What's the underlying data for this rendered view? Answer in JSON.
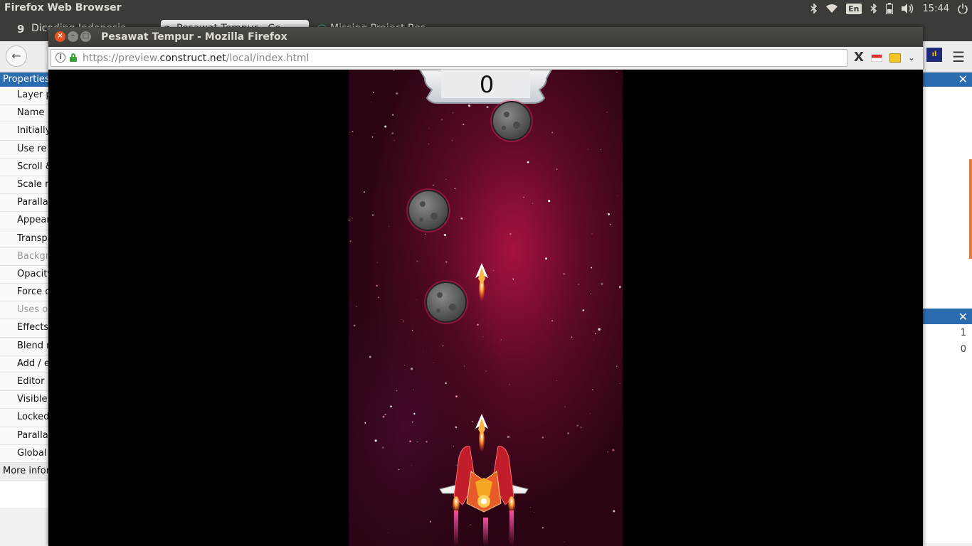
{
  "topbar": {
    "app_title": "Firefox Web Browser",
    "keyboard_layout": "En",
    "clock": "15:44",
    "icons": [
      "bluetooth-icon",
      "wifi-icon",
      "keyboard-layout-icon",
      "bluetooth-icon",
      "battery-icon",
      "volume-icon",
      "power-icon"
    ]
  },
  "background_window": {
    "tabs": [
      {
        "label": "Dicoding Indonesia",
        "icon": "dicoding-icon"
      },
      {
        "label": "Pesawat Tempur - Co",
        "icon": "construct-icon"
      },
      {
        "label": "Missing Project Res",
        "icon": "circle-icon"
      }
    ],
    "properties_panel": {
      "title": "Properties",
      "rows": [
        {
          "label": "Layer p",
          "style": "normal"
        },
        {
          "label": "Name",
          "style": "normal"
        },
        {
          "label": "Initially",
          "style": "normal"
        },
        {
          "label": "Use re",
          "style": "normal"
        },
        {
          "label": "Scroll &",
          "style": "normal"
        },
        {
          "label": "Scale r",
          "style": "normal"
        },
        {
          "label": "Paralla",
          "style": "normal"
        },
        {
          "label": "Appear",
          "style": "normal"
        },
        {
          "label": "Transpa",
          "style": "normal"
        },
        {
          "label": "Backgr",
          "style": "dim"
        },
        {
          "label": "Opacity",
          "style": "normal"
        },
        {
          "label": "Force c",
          "style": "normal"
        },
        {
          "label": "Uses o",
          "style": "dim"
        },
        {
          "label": "Effects",
          "style": "normal"
        },
        {
          "label": "Blend m",
          "style": "normal"
        },
        {
          "label": "Add / e",
          "style": "normal"
        },
        {
          "label": "Editor",
          "style": "normal"
        },
        {
          "label": "Visible",
          "style": "normal"
        },
        {
          "label": "Locked",
          "style": "normal"
        },
        {
          "label": "Paralla",
          "style": "normal"
        },
        {
          "label": "Global",
          "style": "normal"
        },
        {
          "label": "More infor",
          "style": "section"
        }
      ]
    },
    "right_panel_numbers": [
      "1",
      "0"
    ]
  },
  "window": {
    "title": "Pesawat Tempur - Mozilla Firefox",
    "url_host_prefix": "https://preview.",
    "url_domain": "construct.net",
    "url_path": "/local/index.html"
  },
  "game": {
    "score": "0",
    "background_color": "#2a0414",
    "nebula_color": "#a5123e",
    "glow_color": "#ff2a7a"
  }
}
